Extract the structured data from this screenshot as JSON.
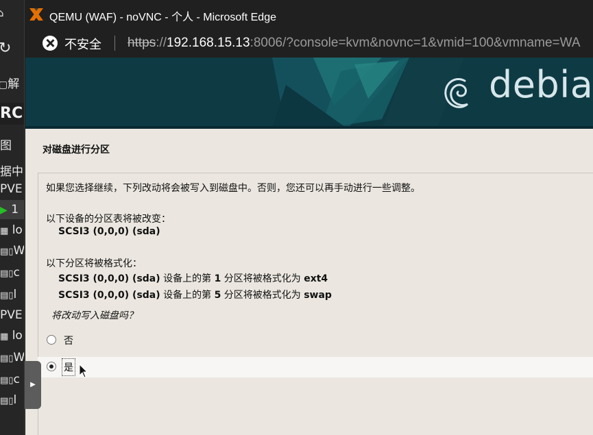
{
  "background_app": {
    "rows": [
      "解",
      "RC",
      "图",
      "据中",
      "PVE",
      "1",
      "lo",
      "W",
      "c",
      "l",
      "PVE",
      "lo",
      "W",
      "c",
      "l"
    ]
  },
  "window": {
    "title": "QEMU (WAF) - noVNC - 个人 - Microsoft Edge",
    "app_icon": "proxmox-x-icon"
  },
  "addressbar": {
    "security_label": "不安全",
    "url_scheme": "https",
    "url_separator": "://",
    "url_host": "192.168.15.13",
    "url_rest": ":8006/?console=kvm&novnc=1&vmid=100&vmname=WA"
  },
  "installer": {
    "brand": "debian",
    "step_title": "对磁盘进行分区",
    "intro": "如果您选择继续，下列改动将会被写入到磁盘中。否则，您还可以再手动进行一些调整。",
    "partition_table_heading": "以下设备的分区表将被改变：",
    "partition_table_devices": [
      "SCSI3 (0,0,0) (sda)"
    ],
    "format_heading": "以下分区将被格式化：",
    "format_items": [
      {
        "device": "SCSI3 (0,0,0) (sda)",
        "mid": " 设备上的第 ",
        "num": "1",
        "mid2": " 分区将被格式化为 ",
        "fs": "ext4"
      },
      {
        "device": "SCSI3 (0,0,0) (sda)",
        "mid": " 设备上的第 ",
        "num": "5",
        "mid2": " 分区将被格式化为 ",
        "fs": "swap"
      }
    ],
    "question": "将改动写入磁盘吗？",
    "options": [
      {
        "label": "否",
        "selected": false
      },
      {
        "label": "是",
        "selected": true
      }
    ]
  },
  "colors": {
    "banner": "#0e3a44",
    "content_bg": "#ebe7e0",
    "titlebar": "#202020"
  }
}
